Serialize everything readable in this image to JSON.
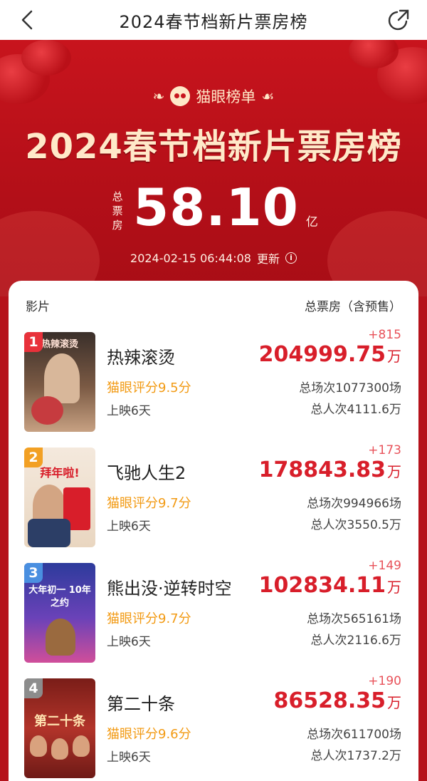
{
  "nav": {
    "title": "2024春节档新片票房榜"
  },
  "hero": {
    "brand": "猫眼榜单",
    "headline": "2024春节档新片票房榜",
    "total_label": "总票房",
    "total_amount": "58.10",
    "total_unit": "亿",
    "update_time": "2024-02-15  06:44:08",
    "update_label": "更新"
  },
  "table": {
    "col_film": "影片",
    "col_box": "总票房（含预售）"
  },
  "movies": [
    {
      "rank": "1",
      "name": "热辣滚烫",
      "score": "猫眼评分9.5分",
      "days": "上映6天",
      "delta": "+815",
      "box": "204999.75",
      "unit": "万",
      "shows": "总场次1077300场",
      "people": "总人次4111.6万",
      "rank_color": "#e8313a"
    },
    {
      "rank": "2",
      "name": "飞驰人生2",
      "score": "猫眼评分9.7分",
      "days": "上映6天",
      "delta": "+173",
      "box": "178843.83",
      "unit": "万",
      "shows": "总场次994966场",
      "people": "总人次3550.5万",
      "rank_color": "#f2a024"
    },
    {
      "rank": "3",
      "name": "熊出没·逆转时空",
      "score": "猫眼评分9.7分",
      "days": "上映6天",
      "delta": "+149",
      "box": "102834.11",
      "unit": "万",
      "shows": "总场次565161场",
      "people": "总人次2116.6万",
      "rank_color": "#4a8fe0"
    },
    {
      "rank": "4",
      "name": "第二十条",
      "score": "猫眼评分9.6分",
      "days": "上映6天",
      "delta": "+190",
      "box": "86528.35",
      "unit": "万",
      "shows": "总场次611700场",
      "people": "总人次1737.2万",
      "rank_color": "#8c8c8c"
    }
  ],
  "posters": [
    {
      "text": "热辣滚烫"
    },
    {
      "text": "拜年啦!"
    },
    {
      "text": "大年初一 10年之约"
    },
    {
      "text": "第二十条"
    }
  ]
}
